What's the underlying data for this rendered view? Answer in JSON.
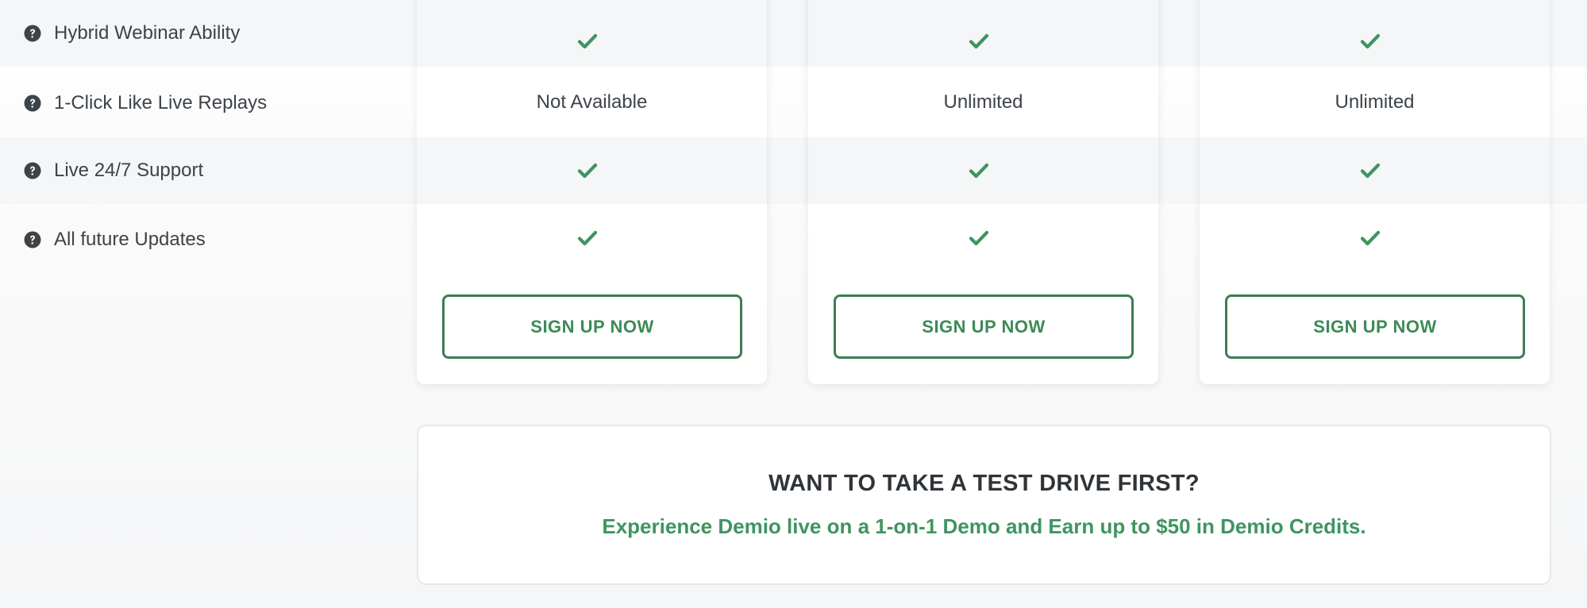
{
  "features": [
    {
      "label": "Hybrid Webinar Ability"
    },
    {
      "label": "1-Click Like Live Replays"
    },
    {
      "label": "Live 24/7 Support"
    },
    {
      "label": "All future Updates"
    }
  ],
  "plans": [
    {
      "replays": "Not Available",
      "signup_label": "SIGN UP NOW"
    },
    {
      "replays": "Unlimited",
      "signup_label": "SIGN UP NOW"
    },
    {
      "replays": "Unlimited",
      "signup_label": "SIGN UP NOW"
    }
  ],
  "promo": {
    "title": "WANT TO TAKE A TEST DRIVE FIRST?",
    "subtitle": "Experience Demio live on a 1-on-1 Demo and Earn up to $50 in Demio Credits."
  },
  "icons": {
    "help": "question-circle-icon",
    "check": "checkmark-icon"
  },
  "colors": {
    "accent": "#3c8a56",
    "button_border": "#3c7d52",
    "stripe": "#f4f6f8",
    "text": "#3d4349"
  }
}
